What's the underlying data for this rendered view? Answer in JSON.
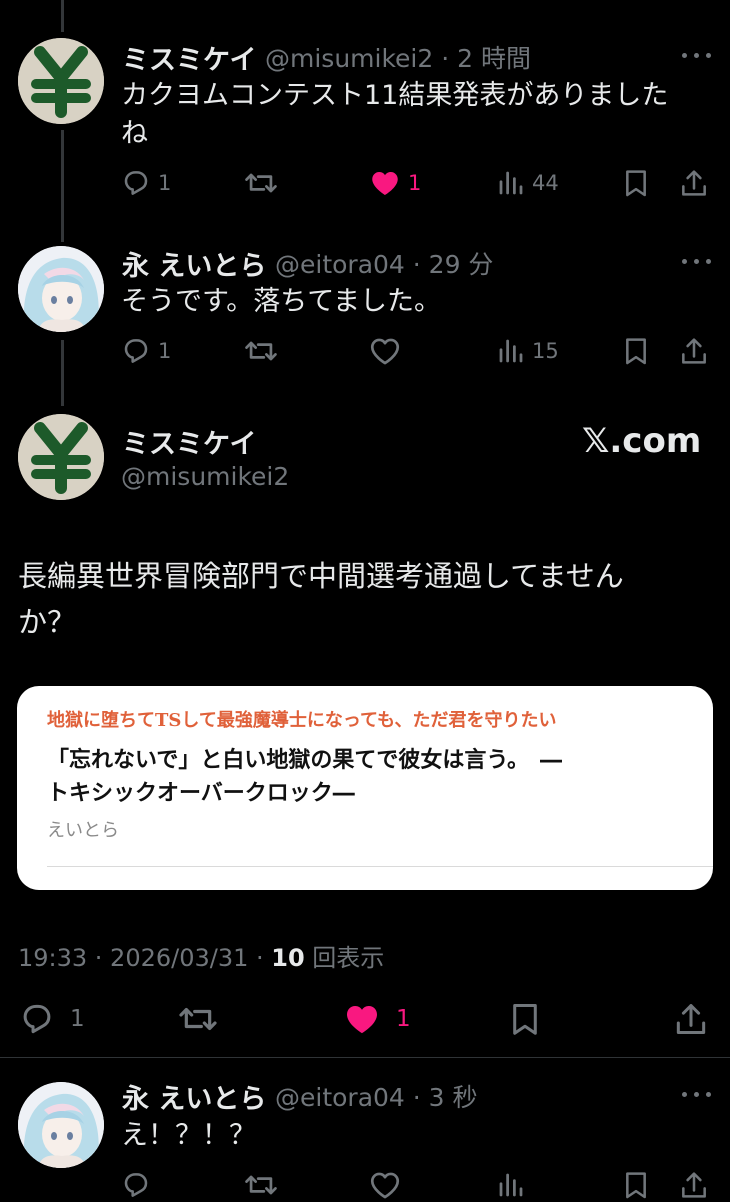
{
  "tweet1": {
    "name": "ミスミケイ",
    "handle_time": "@misumikei2 · 2 時間",
    "text_line1": "カクヨムコンテスト11結果発表がありました",
    "text_line2": "ね",
    "reply_count": "1",
    "like_count": "1",
    "view_count": "44"
  },
  "tweet2": {
    "name": "永 えいとら",
    "handle_time": "@eitora04 · 29 分",
    "text": "そうです。落ちてました。",
    "reply_count": "1",
    "view_count": "15"
  },
  "main_tweet": {
    "name": "ミスミケイ",
    "handle": "@misumikei2",
    "brand": "𝕏.com",
    "text_line1": "長編異世界冒険部門で中間選考通過してません",
    "text_line2": "か？",
    "card": {
      "headline": "地獄に堕ちてTSして最強魔導士になっても、ただ君を守りたい",
      "title_line1": "「忘れないで」と白い地獄の果てで彼女は言う。　―",
      "title_line2": "トキシックオーバークロック―",
      "author": "えいとら"
    },
    "timestamp": "19:33 · 2026/03/31 · ",
    "views_number": "10",
    "views_label": " 回表示",
    "reply_count": "1",
    "like_count": "1"
  },
  "tweet4": {
    "name": "永 えいとら",
    "handle_time": "@eitora04 · 3 秒",
    "text": "え！？！？"
  },
  "colors": {
    "background": "#000000",
    "text": "#e7e9ea",
    "muted": "#71767b",
    "like": "#f91880",
    "card_headline": "#e0613a"
  },
  "icons": [
    "reply-icon",
    "retweet-icon",
    "heart-icon",
    "views-icon",
    "bookmark-icon",
    "share-icon",
    "more-icon"
  ]
}
